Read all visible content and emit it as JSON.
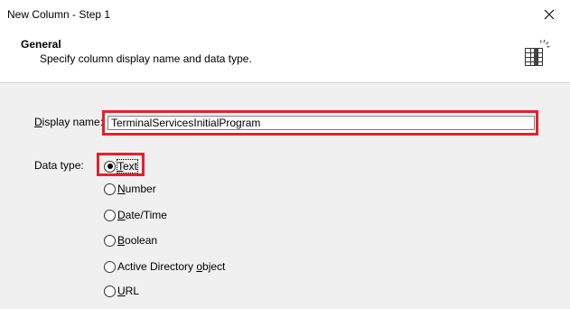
{
  "window": {
    "title": "New Column - Step 1",
    "close_icon": "close-icon"
  },
  "header": {
    "title": "General",
    "subtitle": "Specify column display name and data type.",
    "icon": "column-grid-icon"
  },
  "form": {
    "display_name": {
      "label_prefix": "",
      "label_accel": "D",
      "label_rest": "isplay name:",
      "value": "TerminalServicesInitialProgram"
    },
    "data_type": {
      "label": "Data type:",
      "options": [
        {
          "accel": "T",
          "rest": "ext",
          "prefix": "",
          "checked": true
        },
        {
          "accel": "N",
          "rest": "umber",
          "prefix": "",
          "checked": false
        },
        {
          "accel": "D",
          "rest": "ate/Time",
          "prefix": "",
          "checked": false
        },
        {
          "accel": "B",
          "rest": "oolean",
          "prefix": "",
          "checked": false
        },
        {
          "prefix": "Active Directory ",
          "accel": "o",
          "rest": "bject",
          "checked": false
        },
        {
          "accel": "U",
          "rest": "RL",
          "prefix": "",
          "checked": false
        }
      ]
    }
  },
  "colors": {
    "highlight": "#e8202a",
    "window_bg": "#f0f0f0"
  }
}
